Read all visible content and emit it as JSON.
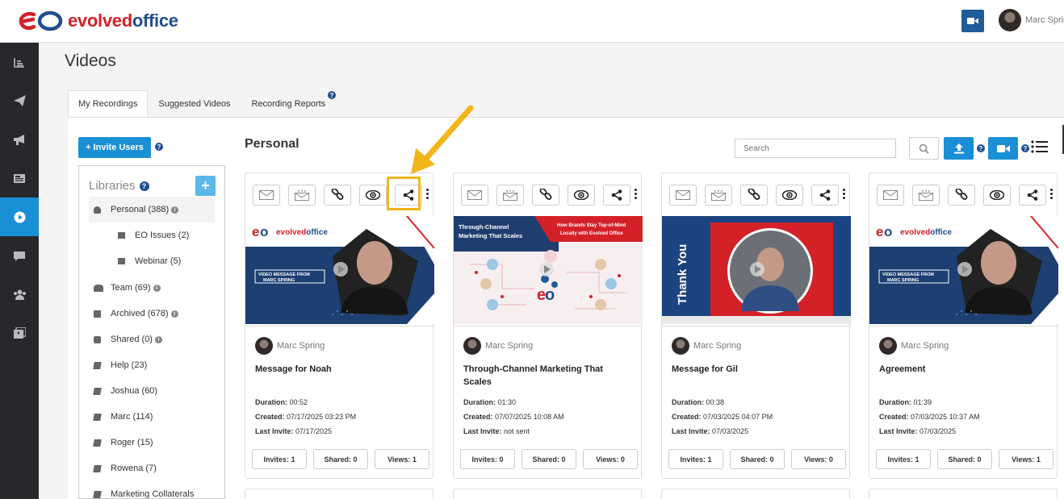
{
  "header": {
    "logo_text_a": "evolved",
    "logo_text_b": "office",
    "user_name": "Marc Sprin"
  },
  "nav": {
    "items": [
      "dashboard-icon",
      "send-icon",
      "megaphone-icon",
      "library-icon",
      "video-icon",
      "chat-icon",
      "team-icon",
      "media-icon"
    ],
    "active_index": 4
  },
  "page": {
    "title": "Videos",
    "tabs": [
      {
        "label": "My Recordings",
        "active": true
      },
      {
        "label": "Suggested Videos",
        "active": false
      },
      {
        "label": "Recording Reports",
        "active": false
      }
    ],
    "help_glyph": "?"
  },
  "sidebar": {
    "invite_label": "+ Invite Users",
    "libraries_title": "Libraries",
    "add_glyph": "+",
    "info_glyph": "i",
    "items": [
      {
        "label": "Personal (388)",
        "icon": "user-icon",
        "info": true,
        "selected": true,
        "sub": false
      },
      {
        "label": "EO Issues (2)",
        "icon": "folder-icon",
        "info": false,
        "selected": false,
        "sub": true
      },
      {
        "label": "Webinar (5)",
        "icon": "folder-icon",
        "info": false,
        "selected": false,
        "sub": true
      },
      {
        "label": "Team (69)",
        "icon": "users-icon",
        "info": true,
        "selected": false,
        "sub": false
      },
      {
        "label": "Archived (678)",
        "icon": "archive-icon",
        "info": true,
        "selected": false,
        "sub": false
      },
      {
        "label": "Shared (0)",
        "icon": "share-box-icon",
        "info": true,
        "selected": false,
        "sub": false
      },
      {
        "label": "Help (23)",
        "icon": "book-icon",
        "info": false,
        "selected": false,
        "sub": false
      },
      {
        "label": "Joshua (60)",
        "icon": "book-icon",
        "info": false,
        "selected": false,
        "sub": false
      },
      {
        "label": "Marc (114)",
        "icon": "book-icon",
        "info": false,
        "selected": false,
        "sub": false
      },
      {
        "label": "Roger (15)",
        "icon": "book-icon",
        "info": false,
        "selected": false,
        "sub": false
      },
      {
        "label": "Rowena (7)",
        "icon": "book-icon",
        "info": false,
        "selected": false,
        "sub": false
      },
      {
        "label": "Marketing Collaterals",
        "icon": "book-icon",
        "info": false,
        "selected": false,
        "sub": false
      }
    ]
  },
  "main": {
    "section_title": "Personal",
    "search_placeholder": "Search"
  },
  "colors": {
    "accent": "#1a8fd6",
    "brand_red": "#d42027",
    "brand_blue": "#1f4e8c",
    "highlight": "#f2b51a"
  },
  "thumb_text": {
    "brand_a": "evolved",
    "brand_b": "office",
    "video_message_line1": "VIDEO MESSAGE FROM",
    "video_message_line2": "MARC SPRING",
    "tc_left_line1": "Through-Channel",
    "tc_left_line2": "Marketing That Scales",
    "tc_right_line1": "How Brands Stay Top-of-Mind",
    "tc_right_line2": "Locally with Evolved Office",
    "thank_you": "Thank You"
  },
  "cards": [
    {
      "author": "Marc Spring",
      "title": "Message for Noah",
      "duration_label": "Duration:",
      "duration": "00:52",
      "created_label": "Created:",
      "created": "07/17/2025 03:23 PM",
      "invite_label": "Last Invite:",
      "last_invite": "07/17/2025",
      "invites": "Invites: 1",
      "shared": "Shared: 0",
      "views": "Views: 1",
      "thumb": "vm"
    },
    {
      "author": "Marc Spring",
      "title": "Through-Channel Marketing That Scales",
      "duration_label": "Duration:",
      "duration": "01:30",
      "created_label": "Created:",
      "created": "07/07/2025 10:08 AM",
      "invite_label": "Last Invite:",
      "last_invite": "not sent",
      "invites": "Invites: 0",
      "shared": "Shared: 0",
      "views": "Views: 0",
      "thumb": "tc"
    },
    {
      "author": "Marc Spring",
      "title": "Message for Gil",
      "duration_label": "Duration:",
      "duration": "00:38",
      "created_label": "Created:",
      "created": "07/03/2025 04:07 PM",
      "invite_label": "Last Invite:",
      "last_invite": "07/03/2025",
      "invites": "Invites: 1",
      "shared": "Shared: 0",
      "views": "Views: 0",
      "thumb": "ty"
    },
    {
      "author": "Marc Spring",
      "title": "Agreement",
      "duration_label": "Duration:",
      "duration": "01:39",
      "created_label": "Created:",
      "created": "07/03/2025 10:37 AM",
      "invite_label": "Last Invite:",
      "last_invite": "07/03/2025",
      "invites": "Invites: 1",
      "shared": "Shared: 0",
      "views": "Views: 1",
      "thumb": "vm"
    }
  ],
  "toolbar_icons": [
    "email-icon",
    "bulk-email-icon",
    "link-icon",
    "preview-eye-icon",
    "share-icon"
  ],
  "annotation": {
    "highlighted_button": "share-icon",
    "card_index": 0
  }
}
